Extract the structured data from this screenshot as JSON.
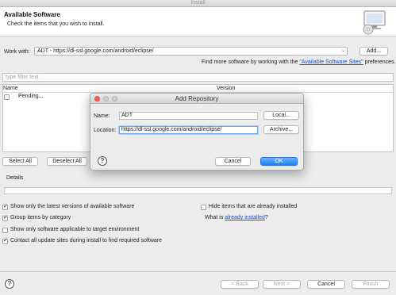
{
  "window": {
    "title": "Install"
  },
  "header": {
    "title": "Available Software",
    "subtitle": "Check the items that you wish to install."
  },
  "work_with": {
    "label": "Work with:",
    "value": "ADT - https://dl-ssl.google.com/android/eclipse/",
    "add_button": "Add..."
  },
  "find_more": {
    "prefix": "Find more software by working with the ",
    "link": "\"Available Software Sites\"",
    "suffix": " preferences."
  },
  "filter": {
    "placeholder": "type filter text"
  },
  "table": {
    "columns": [
      "Name",
      "Version"
    ],
    "rows": [
      {
        "name": "Pending...",
        "version": "",
        "checked": false
      }
    ]
  },
  "select_all": "Select All",
  "deselect_all": "Deselect All",
  "details": {
    "label": "Details"
  },
  "options": {
    "latest_versions": {
      "label": "Show only the latest versions of available software",
      "checked": true
    },
    "group_by_category": {
      "label": "Group items by category",
      "checked": true
    },
    "applicable_only": {
      "label": "Show only software applicable to target environment",
      "checked": false
    },
    "contact_sites": {
      "label": "Contact all update sites during install to find required software",
      "checked": true
    },
    "hide_installed": {
      "label": "Hide items that are already installed",
      "checked": false
    },
    "what_is": {
      "prefix": "What is ",
      "link": "already installed",
      "suffix": "?"
    }
  },
  "footer": {
    "back": "< Back",
    "next": "Next >",
    "cancel": "Cancel",
    "finish": "Finish"
  },
  "dialog": {
    "title": "Add Repository",
    "name_label": "Name:",
    "name_value": "ADT",
    "location_label": "Location:",
    "location_value": "https://dl-ssl.google.com/android/eclipse/",
    "local_button": "Local...",
    "archive_button": "Archive...",
    "cancel_button": "Cancel",
    "ok_button": "OK"
  },
  "colors": {
    "accent": "#1d83f5",
    "link": "#1a4ed8",
    "traffic_close": "#fc605c",
    "traffic_inactive": "#c8c8c8"
  }
}
